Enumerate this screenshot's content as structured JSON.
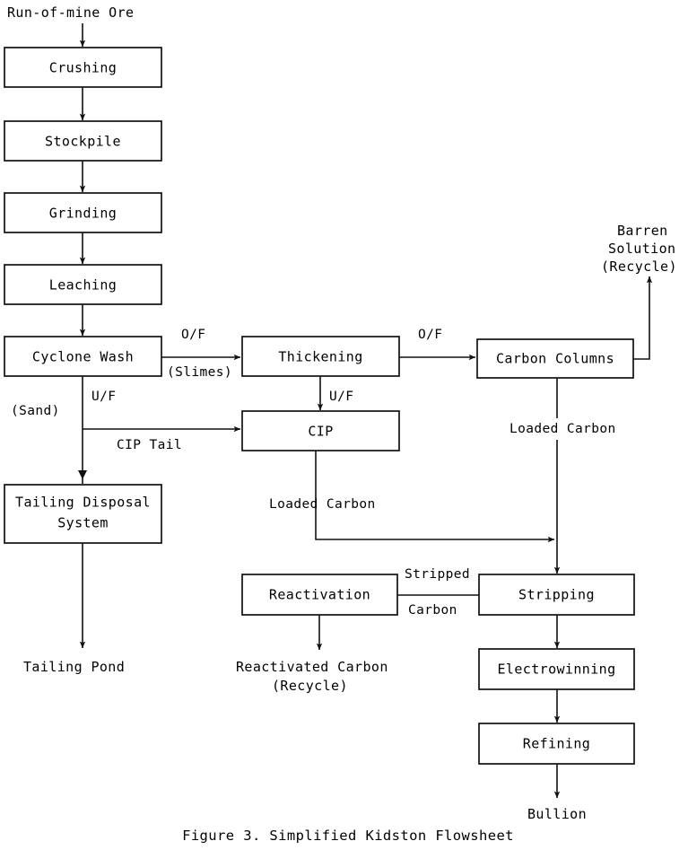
{
  "figure": {
    "caption": "Figure 3.  Simplified Kidston Flowsheet"
  },
  "nodes": {
    "crushing": "Crushing",
    "stockpile": "Stockpile",
    "grinding": "Grinding",
    "leaching": "Leaching",
    "cyclone_wash": "Cyclone Wash",
    "thickening": "Thickening",
    "cip": "CIP",
    "carbon_columns": "Carbon Columns",
    "tailing_disposal_line1": "Tailing Disposal",
    "tailing_disposal_line2": "System",
    "reactivation": "Reactivation",
    "stripping": "Stripping",
    "electrowinning": "Electrowinning",
    "refining": "Refining"
  },
  "terminals": {
    "feed": "Run-of-mine Ore",
    "tailing_pond": "Tailing Pond",
    "reactivated_carbon_line1": "Reactivated Carbon",
    "reactivated_carbon_line2": "(Recycle)",
    "bullion": "Bullion",
    "barren_line1": "Barren",
    "barren_line2": "Solution",
    "barren_line3": "(Recycle)"
  },
  "stream_labels": {
    "of_cyclone_to_thickening": "O/F",
    "slimes": "(Slimes)",
    "uf_cyclone": "U/F",
    "sand": "(Sand)",
    "cip_tail": "CIP Tail",
    "uf_thickening": "U/F",
    "of_thickening_to_carbon": "O/F",
    "loaded_carbon_columns": "Loaded Carbon",
    "loaded_carbon_cip": "Loaded Carbon",
    "stripped": "Stripped",
    "carbon": "Carbon"
  },
  "colors": {
    "ink": "#111111",
    "paper": "#ffffff"
  }
}
